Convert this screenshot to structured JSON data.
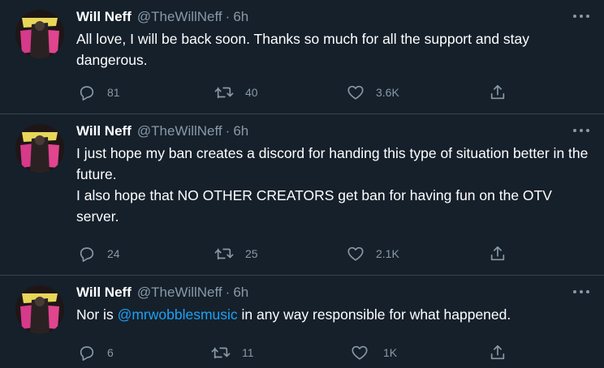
{
  "tweets": [
    {
      "author_name": "Will Neff",
      "author_handle": "@TheWillNeff",
      "separator": "·",
      "time": "6h",
      "text_lines": [
        "All love, I will be back soon. Thanks so much for all the support and stay dangerous."
      ],
      "replies": "81",
      "retweets": "40",
      "likes": "3.6K"
    },
    {
      "author_name": "Will Neff",
      "author_handle": "@TheWillNeff",
      "separator": "·",
      "time": "6h",
      "text_lines": [
        "I just hope my ban creates a discord for handing this type of situation better in the future.",
        "I also hope that NO OTHER CREATORS get ban for having fun on the OTV server."
      ],
      "replies": "24",
      "retweets": "25",
      "likes": "2.1K"
    },
    {
      "author_name": "Will Neff",
      "author_handle": "@TheWillNeff",
      "separator": "·",
      "time": "6h",
      "text_before": "Nor is ",
      "mention": "@mrwobblesmusic",
      "text_after": " in any way responsible for what happened.",
      "replies": "6",
      "retweets": "11",
      "likes": "1K"
    }
  ],
  "icons": {
    "avatar": "avatar-image",
    "more": "more-options-icon",
    "reply": "reply-icon",
    "retweet": "retweet-icon",
    "like": "heart-icon",
    "share": "share-icon"
  },
  "colors": {
    "background": "#15202b",
    "divider": "#38444d",
    "secondary_text": "#8899a6",
    "link": "#1da1f2"
  }
}
